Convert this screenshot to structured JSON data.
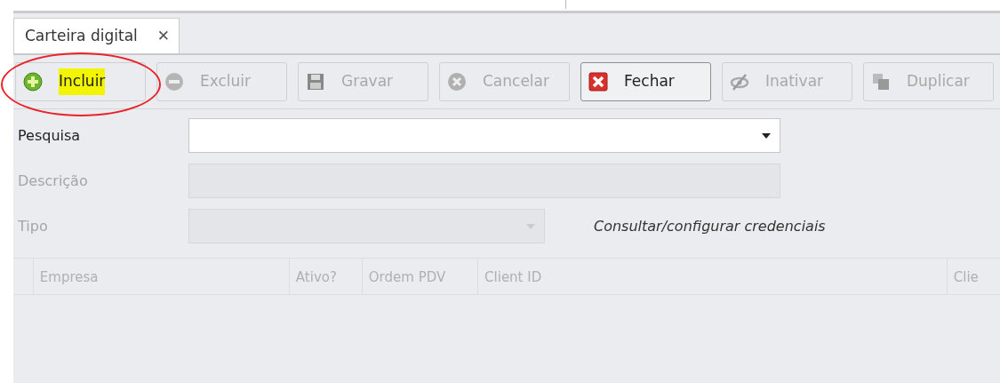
{
  "tab": {
    "label": "Carteira digital",
    "close": "✕",
    "selected": true
  },
  "toolbar": [
    {
      "kind": "add",
      "label": "Incluir",
      "disabled": false,
      "highlighted": true,
      "circled": true
    },
    {
      "kind": "remove",
      "label": "Excluir",
      "disabled": true,
      "highlighted": false,
      "circled": false
    },
    {
      "kind": "save",
      "label": "Gravar",
      "disabled": true,
      "highlighted": false,
      "circled": false
    },
    {
      "kind": "cancel",
      "label": "Cancelar",
      "disabled": true,
      "highlighted": false,
      "circled": false
    },
    {
      "kind": "close",
      "label": "Fechar",
      "disabled": false,
      "highlighted": false,
      "circled": false
    },
    {
      "kind": "hide",
      "label": "Inativar",
      "disabled": true,
      "highlighted": false,
      "circled": false
    },
    {
      "kind": "copy",
      "label": "Duplicar",
      "disabled": true,
      "highlighted": false,
      "circled": false
    }
  ],
  "fields": [
    {
      "kind": "combo",
      "label": "Pesquisa",
      "disabled": false
    },
    {
      "kind": "text",
      "label": "Descrição",
      "disabled": true
    },
    {
      "kind": "combo",
      "label": "Tipo",
      "disabled": true,
      "link": "Consultar/configurar credenciais"
    }
  ],
  "table": {
    "columns": [
      "Empresa",
      "Ativo?",
      "Ordem PDV",
      "Client ID",
      "Clie"
    ]
  }
}
